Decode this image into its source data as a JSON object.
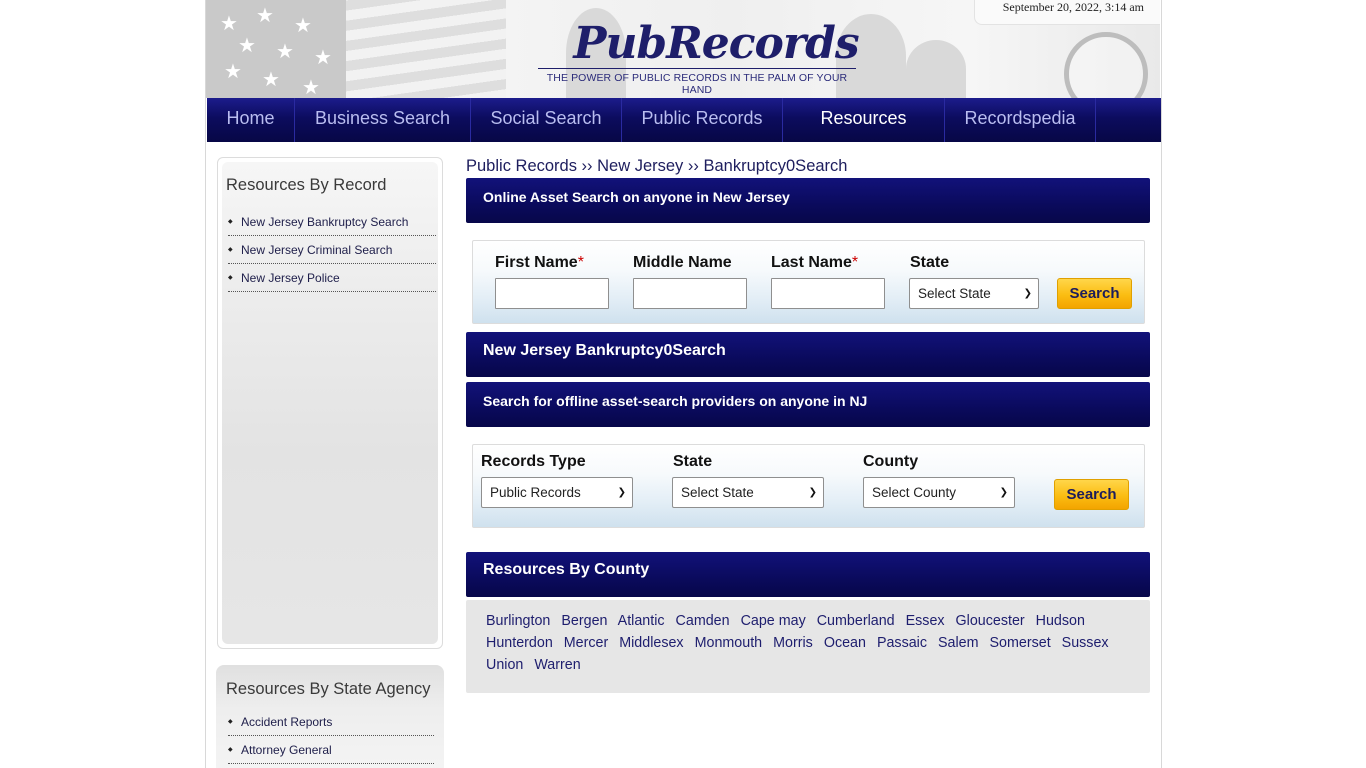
{
  "header": {
    "logo_title": "PubRecords",
    "logo_tagline": "THE POWER OF PUBLIC RECORDS IN THE PALM OF YOUR HAND",
    "datetime": "September 20, 2022, 3:14 am"
  },
  "nav": {
    "items": [
      {
        "label": "Home"
      },
      {
        "label": "Business Search"
      },
      {
        "label": "Social Search"
      },
      {
        "label": "Public Records"
      },
      {
        "label": "Resources"
      },
      {
        "label": "Recordspedia"
      }
    ],
    "active": "Resources"
  },
  "sidebar": {
    "record_title": "Resources By Record",
    "record_items": [
      {
        "label": "New Jersey Bankruptcy Search"
      },
      {
        "label": "New Jersey Criminal Search"
      },
      {
        "label": "New Jersey Police"
      }
    ],
    "agency_title": "Resources By State Agency",
    "agency_items": [
      {
        "label": "Accident Reports"
      },
      {
        "label": "Attorney General"
      }
    ]
  },
  "breadcrumb": "Public Records ›› New Jersey ›› Bankruptcy0Search",
  "asset_search": {
    "title": "Online Asset Search on anyone in  New Jersey",
    "first_name_label": "First Name",
    "middle_name_label": "Middle Name",
    "last_name_label": "Last Name",
    "required_mark": "*",
    "state_label": "State",
    "state_selected": "Select State",
    "search_button": "Search"
  },
  "section_title": "New Jersey Bankruptcy0Search",
  "offline_search": {
    "title": "Search for offline asset-search providers on anyone in  NJ",
    "records_type_label": "Records Type",
    "records_type_selected": "Public Records",
    "state_label": "State",
    "state_selected": "Select State",
    "county_label": "County",
    "county_selected": "Select County",
    "search_button": "Search"
  },
  "counties": {
    "title": "Resources By County",
    "list": [
      "Burlington",
      "Bergen",
      "Atlantic",
      "Camden",
      "Cape may",
      "Cumberland",
      "Essex",
      "Gloucester",
      "Hudson",
      "Hunterdon",
      "Mercer",
      "Middlesex",
      "Monmouth",
      "Morris",
      "Ocean",
      "Passaic",
      "Salem",
      "Somerset",
      "Sussex",
      "Union",
      "Warren"
    ]
  },
  "colors": {
    "nav_dark": "#0a0a5c",
    "button_yellow": "#fbbd12",
    "link_blue": "#1e1e6e"
  }
}
